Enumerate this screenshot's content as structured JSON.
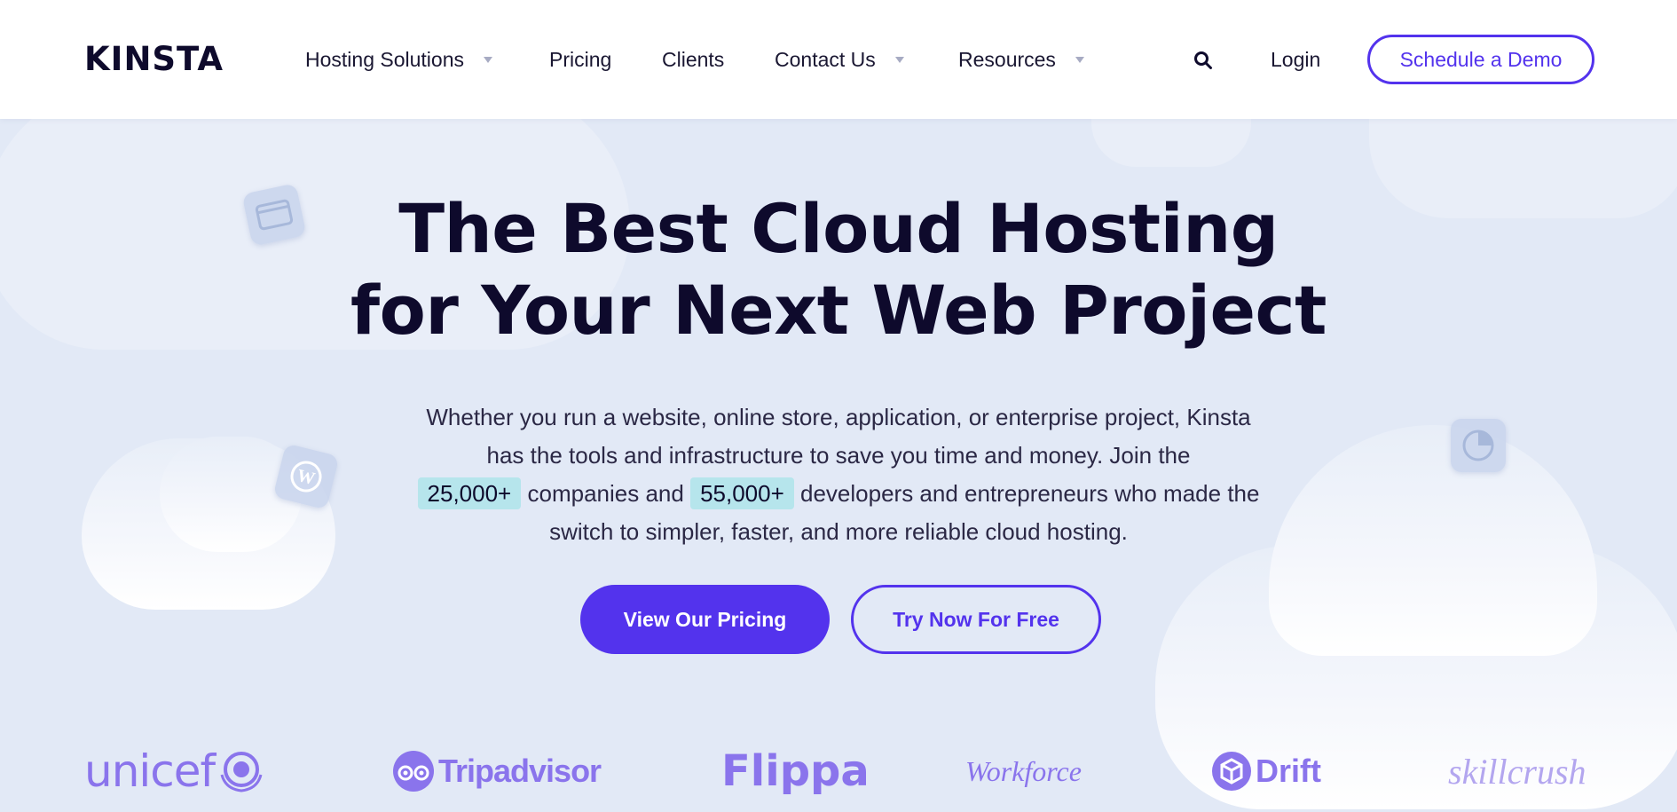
{
  "brand": {
    "logo_text": "KINSTA"
  },
  "nav": {
    "items": [
      {
        "label": "Hosting Solutions",
        "has_dropdown": true
      },
      {
        "label": "Pricing",
        "has_dropdown": false
      },
      {
        "label": "Clients",
        "has_dropdown": false
      },
      {
        "label": "Contact Us",
        "has_dropdown": true
      },
      {
        "label": "Resources",
        "has_dropdown": true
      }
    ],
    "search_icon": "search-icon",
    "login_label": "Login",
    "demo_label": "Schedule a Demo"
  },
  "hero": {
    "title_line1": "The Best Cloud Hosting",
    "title_line2": "for Your Next Web Project",
    "desc_line1": "Whether you run a website, online store, application, or enterprise project, Kinsta",
    "desc_line2": "has the tools and infrastructure to save you time and money. Join the",
    "companies_count": "25,000+",
    "companies_text": "companies and",
    "developers_count": "55,000+",
    "developers_text": "developers and entrepreneurs who made the",
    "desc_line4": "switch to simpler, faster, and more reliable cloud hosting.",
    "primary_cta": "View Our Pricing",
    "secondary_cta": "Try Now For Free"
  },
  "clients": [
    {
      "name": "unicef"
    },
    {
      "name": "Tripadvisor"
    },
    {
      "name": "Flippa"
    },
    {
      "name": "Workforce"
    },
    {
      "name": "Drift"
    },
    {
      "name": "skillcrush"
    }
  ],
  "colors": {
    "accent": "#5333ed",
    "text_dark": "#0e0a2c",
    "hero_bg": "#e2e9f6",
    "highlight": "#b6e5ec",
    "logo_purple": "#8a74ec"
  }
}
